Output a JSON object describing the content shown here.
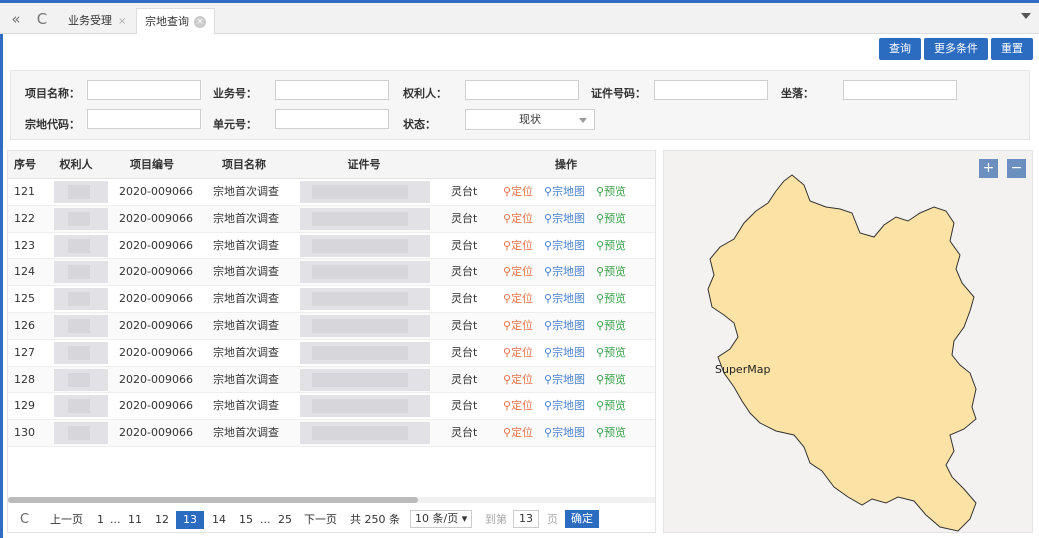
{
  "tabs": {
    "back_icon": "«",
    "refresh_icon": "C",
    "items": [
      {
        "label": "业务受理",
        "close": "×"
      },
      {
        "label": "宗地查询",
        "close": "×"
      }
    ]
  },
  "toolbar": {
    "query": "查询",
    "more": "更多条件",
    "reset": "重置"
  },
  "form": {
    "project_name": "项目名称：",
    "business_no": "业务号：",
    "obligee": "权利人：",
    "cert_no": "证件号码：",
    "location": "坐落：",
    "parcel_code": "宗地代码：",
    "unit_no": "单元号：",
    "status": "状态：",
    "status_value": "现状"
  },
  "table": {
    "headers": [
      "序号",
      "权利人",
      "项目编号",
      "项目名称",
      "证件号",
      "",
      "操作"
    ],
    "rows": [
      {
        "no": "121",
        "proj_no": "2020-009066",
        "proj_name": "宗地首次调查",
        "addr": "灵台t"
      },
      {
        "no": "122",
        "proj_no": "2020-009066",
        "proj_name": "宗地首次调查",
        "addr": "灵台t"
      },
      {
        "no": "123",
        "proj_no": "2020-009066",
        "proj_name": "宗地首次调查",
        "addr": "灵台t"
      },
      {
        "no": "124",
        "proj_no": "2020-009066",
        "proj_name": "宗地首次调查",
        "addr": "灵台t"
      },
      {
        "no": "125",
        "proj_no": "2020-009066",
        "proj_name": "宗地首次调查",
        "addr": "灵台t"
      },
      {
        "no": "126",
        "proj_no": "2020-009066",
        "proj_name": "宗地首次调查",
        "addr": "灵台t"
      },
      {
        "no": "127",
        "proj_no": "2020-009066",
        "proj_name": "宗地首次调查",
        "addr": "灵台t"
      },
      {
        "no": "128",
        "proj_no": "2020-009066",
        "proj_name": "宗地首次调查",
        "addr": "灵台t"
      },
      {
        "no": "129",
        "proj_no": "2020-009066",
        "proj_name": "宗地首次调查",
        "addr": "灵台t"
      },
      {
        "no": "130",
        "proj_no": "2020-009066",
        "proj_name": "宗地首次调查",
        "addr": "灵台t"
      }
    ],
    "ops": {
      "locate": "定位",
      "parcel_map": "宗地图",
      "preview": "预览"
    }
  },
  "pager": {
    "refresh_icon": "C",
    "prev": "上一页",
    "pages": [
      "1",
      "...",
      "11",
      "12",
      "13",
      "14",
      "15",
      "...",
      "25"
    ],
    "current": "13",
    "next": "下一页",
    "total": "共 250 条",
    "page_size": "10 条/页",
    "goto_label": "到第",
    "goto_value": "13",
    "page_unit": "页",
    "confirm": "确定"
  },
  "map": {
    "zoom_in": "+",
    "zoom_out": "−",
    "label": "SuperMap",
    "fill": "#fce3a5",
    "stroke": "#333333"
  },
  "colors": {
    "accent": "#2b6cc0",
    "locate": "#e8734a",
    "map": "#4b82cf",
    "preview": "#3aa04a"
  }
}
